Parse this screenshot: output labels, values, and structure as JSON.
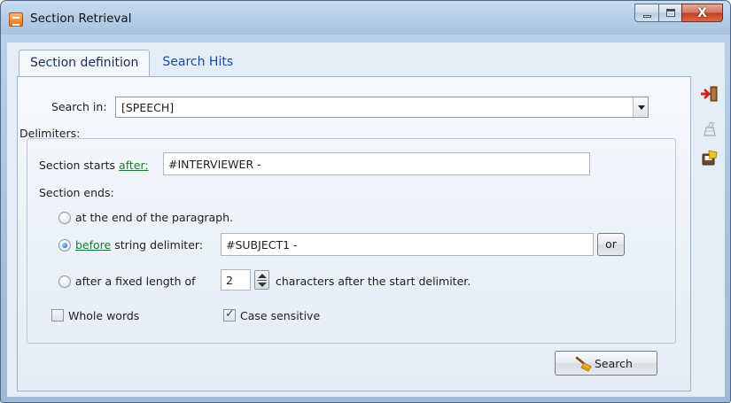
{
  "window": {
    "title": "Section Retrieval",
    "minimize_icon": "minimize-icon",
    "maximize_icon": "maximize-icon",
    "close_icon": "close-icon",
    "close_glyph": "X"
  },
  "tabs": [
    {
      "label": "Section definition",
      "active": true
    },
    {
      "label": "Search Hits",
      "active": false
    }
  ],
  "search_in": {
    "label": "Search in:",
    "value": "[SPEECH]"
  },
  "delimiters": {
    "title": "Delimiters:",
    "section_starts_label": "Section starts",
    "after_link": "after:",
    "start_value": "#INTERVIEWER -",
    "section_ends_label": "Section ends:",
    "option_paragraph": "at the end of the paragraph.",
    "before_link": "before",
    "option_string_delimiter": "string delimiter:",
    "end_value": "#SUBJECT1 -",
    "or_button": "or",
    "option_fixed_prefix": "after a fixed length of",
    "fixed_length": "2",
    "option_fixed_suffix": "characters after the start delimiter.",
    "selected_option": "before",
    "whole_words_label": "Whole words",
    "whole_words_checked": false,
    "case_sensitive_label": "Case sensitive",
    "case_sensitive_checked": true
  },
  "search_button": "Search",
  "side_toolbar": [
    "exit-icon",
    "clear-icon",
    "save-icon"
  ],
  "colors": {
    "link": "#1b7d2b",
    "tab_text": "#1d49a0",
    "close_button": "#c2401f"
  }
}
